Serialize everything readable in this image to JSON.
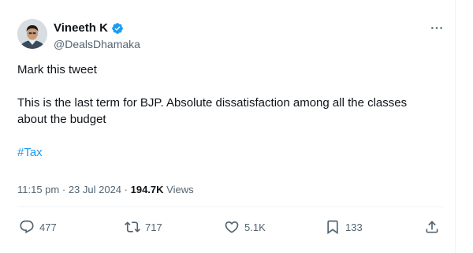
{
  "tweet": {
    "author_name": "Vineeth K",
    "handle": "@DealsDhamaka",
    "line1": "Mark this tweet",
    "line2": "This is the last term for BJP. Absolute dissatisfaction among all the classes about the budget",
    "hashtag": "#Tax",
    "time": "11:15 pm",
    "separator": " · ",
    "date": "23 Jul 2024",
    "views_count": "194.7K",
    "views_label": "Views"
  },
  "actions": {
    "replies": "477",
    "reposts": "717",
    "likes": "5.1K",
    "bookmarks": "133"
  },
  "icons": {
    "verified": "verified-badge-icon",
    "more": "more-dots-icon",
    "reply": "reply-bubble-icon",
    "repost": "repost-arrows-icon",
    "like": "heart-icon",
    "bookmark": "bookmark-icon",
    "share": "share-upload-icon"
  },
  "colors": {
    "text": "#0f1419",
    "secondary": "#536471",
    "accent": "#1d9bf0",
    "divider": "#eff3f4"
  }
}
